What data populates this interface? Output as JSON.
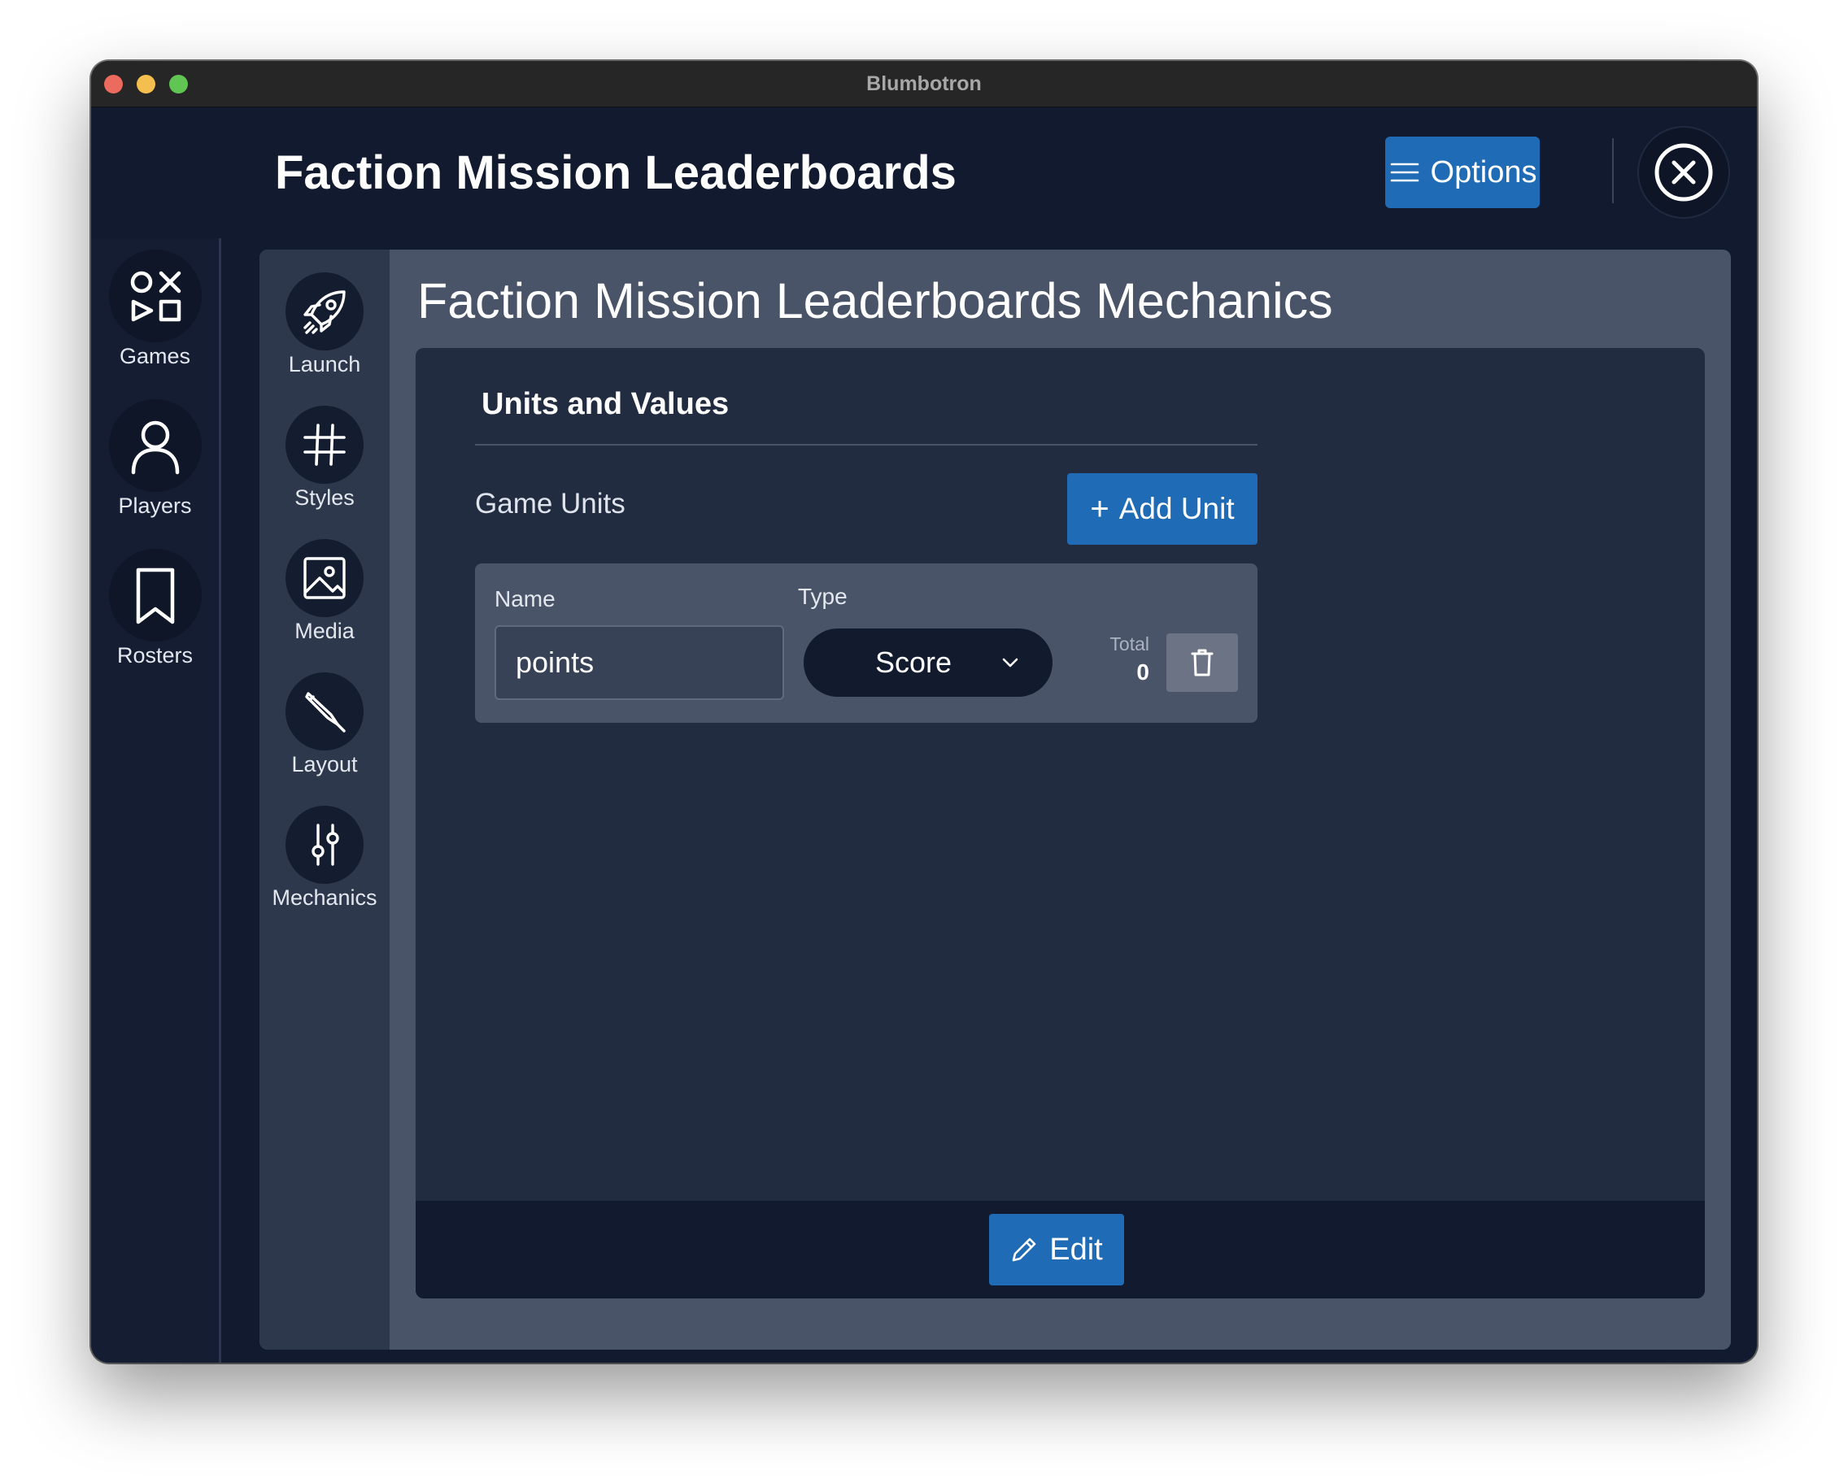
{
  "window": {
    "title": "Blumbotron"
  },
  "header": {
    "title": "Faction Mission Leaderboards",
    "options_label": "Options",
    "options_icon": "menu-icon",
    "close_icon": "close-circle-icon"
  },
  "nav": {
    "items": [
      {
        "label": "Games",
        "icon": "games-shapes-icon"
      },
      {
        "label": "Players",
        "icon": "player-icon"
      },
      {
        "label": "Rosters",
        "icon": "bookmark-icon"
      }
    ]
  },
  "subnav": {
    "items": [
      {
        "label": "Launch",
        "icon": "rocket-icon"
      },
      {
        "label": "Styles",
        "icon": "hash-icon"
      },
      {
        "label": "Media",
        "icon": "image-icon"
      },
      {
        "label": "Layout",
        "icon": "pen-icon"
      },
      {
        "label": "Mechanics",
        "icon": "sliders-icon"
      }
    ]
  },
  "main": {
    "title": "Faction Mission Leaderboards Mechanics",
    "section_title": "Units and Values",
    "game_units_label": "Game Units",
    "add_unit_label": "Add Unit",
    "units": [
      {
        "name_label": "Name",
        "name_value": "points",
        "type_label": "Type",
        "type_value": "Score",
        "total_label": "Total",
        "total_value": "0"
      }
    ],
    "edit_label": "Edit"
  },
  "colors": {
    "background": "#111a2e",
    "panel": "#4a5468",
    "card": "#222c41",
    "accent": "#1f6bb5"
  }
}
